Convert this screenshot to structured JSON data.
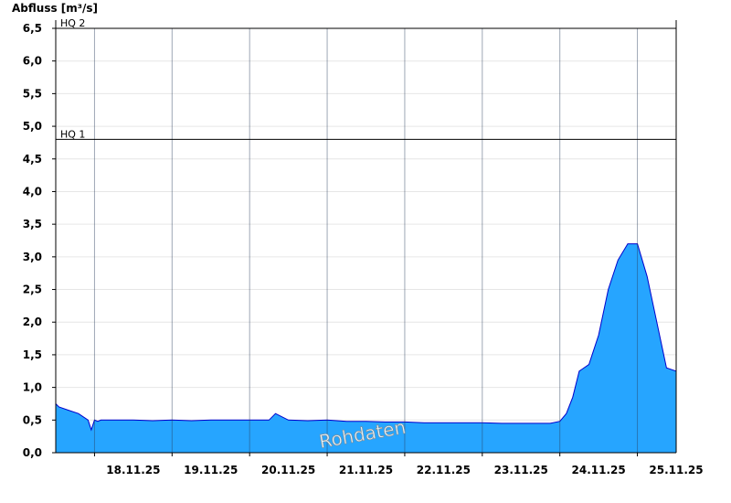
{
  "chart_data": {
    "type": "area",
    "ylabel": "Abfluss [m³/s]",
    "ylim": [
      0,
      6.5
    ],
    "yticks": [
      "0,0",
      "0,5",
      "1,0",
      "1,5",
      "2,0",
      "2,5",
      "3,0",
      "3,5",
      "4,0",
      "4,5",
      "5,0",
      "5,5",
      "6,0",
      "6,5"
    ],
    "yticks_values": [
      0,
      0.5,
      1,
      1.5,
      2,
      2.5,
      3,
      3.5,
      4,
      4.5,
      5,
      5.5,
      6,
      6.5
    ],
    "xlim": [
      "17.11.25 12:00",
      "25.11.25 12:00"
    ],
    "xticks": [
      "18.11.25",
      "19.11.25",
      "20.11.25",
      "21.11.25",
      "22.11.25",
      "23.11.25",
      "24.11.25",
      "25.11.25"
    ],
    "thresholds": [
      {
        "label": "HQ 2",
        "value": 6.5
      },
      {
        "label": "HQ 1",
        "value": 4.8
      }
    ],
    "watermark": "Rohdaten",
    "grid": true,
    "fill_color": "#26a5ff",
    "line_color": "#0000cc",
    "series": [
      {
        "x": [
          "17.11.25 12:00",
          "17.11.25 13:00",
          "17.11.25 16:00",
          "17.11.25 19:00",
          "17.11.25 22:00",
          "17.11.25 23:00",
          "18.11.25 00:00",
          "18.11.25 01:00",
          "18.11.25 02:00",
          "18.11.25 03:00",
          "18.11.25 06:00",
          "18.11.25 12:00",
          "18.11.25 18:00",
          "19.11.25 00:00",
          "19.11.25 06:00",
          "19.11.25 12:00",
          "19.11.25 18:00",
          "20.11.25 00:00",
          "20.11.25 06:00",
          "20.11.25 08:00",
          "20.11.25 12:00",
          "20.11.25 18:00",
          "21.11.25 00:00",
          "21.11.25 06:00",
          "21.11.25 12:00",
          "21.11.25 18:00",
          "22.11.25 00:00",
          "22.11.25 06:00",
          "22.11.25 12:00",
          "22.11.25 18:00",
          "23.11.25 00:00",
          "23.11.25 06:00",
          "23.11.25 12:00",
          "23.11.25 18:00",
          "23.11.25 21:00",
          "24.11.25 00:00",
          "24.11.25 02:00",
          "24.11.25 04:00",
          "24.11.25 06:00",
          "24.11.25 09:00",
          "24.11.25 12:00",
          "24.11.25 15:00",
          "24.11.25 18:00",
          "24.11.25 21:00",
          "25.11.25 00:00",
          "25.11.25 03:00",
          "25.11.25 06:00",
          "25.11.25 09:00",
          "25.11.25 12:00"
        ],
        "y": [
          0.75,
          0.7,
          0.65,
          0.6,
          0.5,
          0.35,
          0.5,
          0.48,
          0.5,
          0.5,
          0.5,
          0.5,
          0.49,
          0.5,
          0.49,
          0.5,
          0.5,
          0.5,
          0.5,
          0.6,
          0.5,
          0.49,
          0.5,
          0.48,
          0.48,
          0.47,
          0.47,
          0.46,
          0.46,
          0.46,
          0.46,
          0.45,
          0.45,
          0.45,
          0.45,
          0.48,
          0.6,
          0.85,
          1.25,
          1.35,
          1.8,
          2.5,
          2.95,
          3.2,
          3.2,
          2.7,
          2.0,
          1.3,
          1.25
        ]
      }
    ]
  }
}
